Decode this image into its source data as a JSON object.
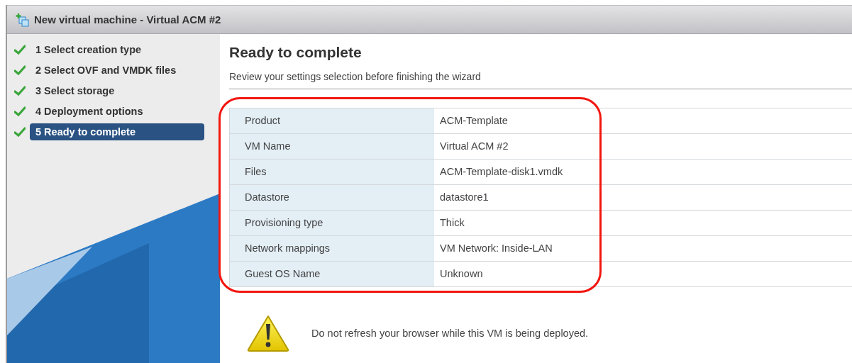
{
  "window": {
    "title": "New virtual machine - Virtual ACM #2"
  },
  "steps": [
    {
      "label": "1 Select creation type",
      "checked": true,
      "selected": false
    },
    {
      "label": "2 Select OVF and VMDK files",
      "checked": true,
      "selected": false
    },
    {
      "label": "3 Select storage",
      "checked": true,
      "selected": false
    },
    {
      "label": "4 Deployment options",
      "checked": true,
      "selected": false
    },
    {
      "label": "5 Ready to complete",
      "checked": true,
      "selected": true
    }
  ],
  "page": {
    "title": "Ready to complete",
    "subtitle": "Review your settings selection before finishing the wizard"
  },
  "summary": {
    "highlighted": true,
    "rows": [
      {
        "label": "Product",
        "value": "ACM-Template"
      },
      {
        "label": "VM Name",
        "value": "Virtual ACM #2"
      },
      {
        "label": "Files",
        "value": "ACM-Template-disk1.vmdk"
      },
      {
        "label": "Datastore",
        "value": "datastore1"
      },
      {
        "label": "Provisioning type",
        "value": "Thick"
      },
      {
        "label": "Network mappings",
        "value": "VM Network: Inside-LAN"
      },
      {
        "label": "Guest OS Name",
        "value": "Unknown"
      }
    ]
  },
  "warning": {
    "text": "Do not refresh your browser while this VM is being deployed."
  }
}
